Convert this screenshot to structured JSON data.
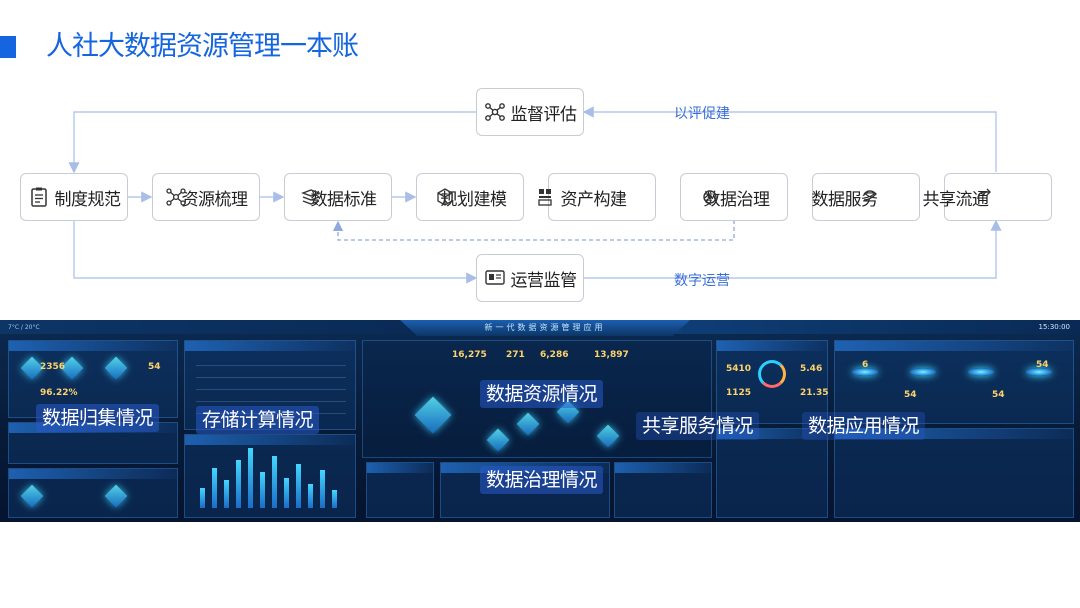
{
  "page": {
    "title": "人社大数据资源管理一本账"
  },
  "flow": {
    "top_node": {
      "label": "监督评估",
      "icon": "network-icon"
    },
    "bottom_node": {
      "label": "运营监管",
      "icon": "monitor-icon"
    },
    "top_edge_label": "以评促建",
    "bottom_edge_label": "数字运营",
    "nodes": [
      {
        "label": "制度规范",
        "icon": "clipboard-icon"
      },
      {
        "label": "资源梳理",
        "icon": "network-icon"
      },
      {
        "label": "数据标准",
        "icon": "layers-icon"
      },
      {
        "label": "规划建模",
        "icon": "cube-icon"
      },
      {
        "label": "资产构建",
        "icon": "grid-icon"
      },
      {
        "label": "数据治理",
        "icon": "gear-icon"
      },
      {
        "label": "数据服务",
        "icon": "swirl-icon"
      },
      {
        "label": "共享流通",
        "icon": "refresh-icon"
      }
    ]
  },
  "dashboard": {
    "title": "新一代数据资源管理应用",
    "time": "15:30:00",
    "weather": "7°C / 20°C",
    "stats": [
      "16,275",
      "271",
      "6,286",
      "13,897"
    ],
    "stat_small": [
      "5410",
      "5.46",
      "1125",
      "21.35",
      "2356",
      "54",
      "96.22%",
      "6",
      "54",
      "54",
      "54"
    ],
    "overlays": {
      "collect": "数据归集情况",
      "storage": "存储计算情况",
      "resource": "数据资源情况",
      "governance": "数据治理情况",
      "share": "共享服务情况",
      "application": "数据应用情况"
    }
  }
}
